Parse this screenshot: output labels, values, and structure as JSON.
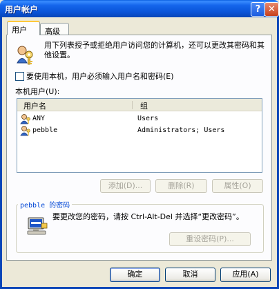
{
  "window": {
    "title": "用户帐户"
  },
  "titlebar": {
    "help_glyph": "?",
    "close_glyph": "✕"
  },
  "tabs": [
    {
      "label": "用户"
    },
    {
      "label": "高级"
    }
  ],
  "intro": {
    "text": "用下列表授予或拒绝用户访问您的计算机，还可以更改其密码和其他设置。",
    "icon": "users-keys-icon"
  },
  "require_login": {
    "label": "要使用本机，用户必须输入用户名和密码(E)",
    "checked": false
  },
  "users_list": {
    "label": "本机用户(U):",
    "columns": [
      "用户名",
      "组"
    ],
    "rows": [
      {
        "name": "ANY",
        "group": "Users"
      },
      {
        "name": "pebble",
        "group": "Administrators; Users"
      }
    ]
  },
  "list_buttons": {
    "add": "添加(D)...",
    "remove": "删除(R)",
    "properties": "属性(O)"
  },
  "password": {
    "legend": "pebble 的密码",
    "text": "要更改您的密码，请按 Ctrl-Alt-Del 并选择“更改密码”。",
    "reset": "重设密码(P)...",
    "icon": "computer-password-icon"
  },
  "footer": {
    "ok": "确定",
    "cancel": "取消",
    "apply": "应用(A)"
  },
  "colors": {
    "titlebar": "#0a54d8",
    "dialog": "#ece9d8",
    "panel": "#fcfcfe",
    "tab_highlight": "#ffc83c"
  }
}
